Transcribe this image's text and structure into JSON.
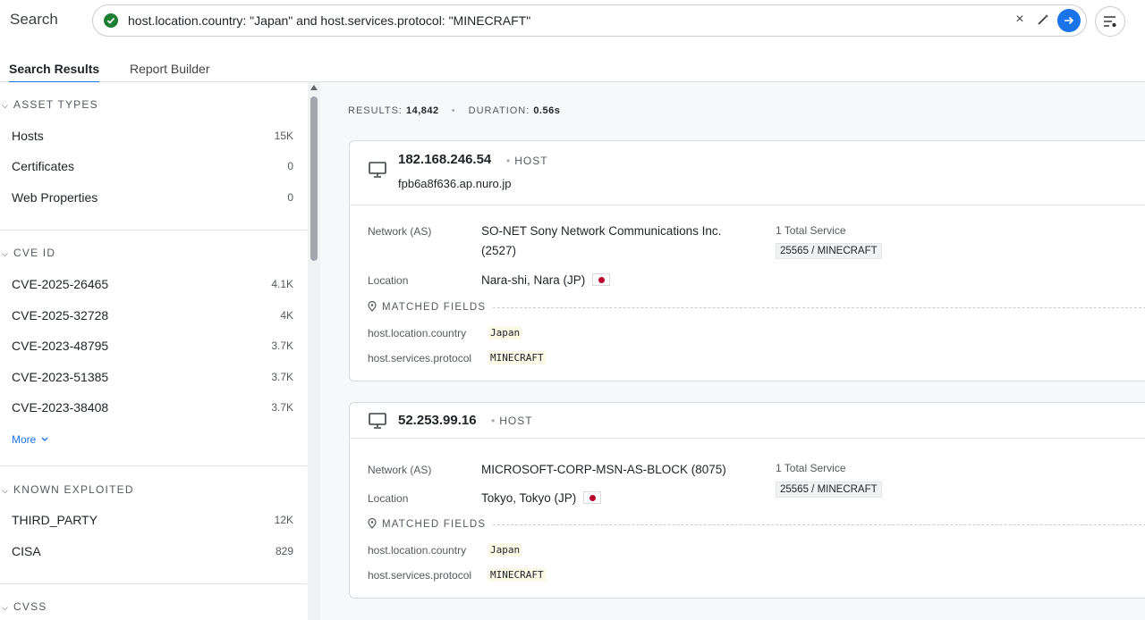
{
  "header": {
    "title": "Search",
    "query": "host.location.country: \"Japan\" and host.services.protocol: \"MINECRAFT\"",
    "clear_glyph": "×"
  },
  "tabs": [
    {
      "label": "Search Results",
      "active": true
    },
    {
      "label": "Report Builder",
      "active": false
    }
  ],
  "sidebar": {
    "asset_types": {
      "title": "ASSET TYPES",
      "items": [
        {
          "label": "Hosts",
          "count": "15K"
        },
        {
          "label": "Certificates",
          "count": "0"
        },
        {
          "label": "Web Properties",
          "count": "0"
        }
      ]
    },
    "cve_id": {
      "title": "CVE ID",
      "items": [
        {
          "label": "CVE-2025-26465",
          "count": "4.1K"
        },
        {
          "label": "CVE-2025-32728",
          "count": "4K"
        },
        {
          "label": "CVE-2023-48795",
          "count": "3.7K"
        },
        {
          "label": "CVE-2023-51385",
          "count": "3.7K"
        },
        {
          "label": "CVE-2023-38408",
          "count": "3.7K"
        }
      ],
      "more_label": "More"
    },
    "known_exploited": {
      "title": "KNOWN EXPLOITED",
      "items": [
        {
          "label": "THIRD_PARTY",
          "count": "12K"
        },
        {
          "label": "CISA",
          "count": "829"
        }
      ]
    },
    "cvss": {
      "title": "CVSS"
    }
  },
  "stats": {
    "results_label": "RESULTS:",
    "results_value": "14,842",
    "duration_label": "DURATION:",
    "duration_value": "0.56s"
  },
  "results": [
    {
      "ip": "182.168.246.54",
      "kind": "HOST",
      "hostname": "fpb6a8f636.ap.nuro.jp",
      "network_label": "Network (AS)",
      "network_line1": "SO-NET Sony Network Communications Inc.",
      "network_line2": "(2527)",
      "location_label": "Location",
      "location": "Nara-shi, Nara (JP)",
      "services_title": "1 Total Service",
      "service": "25565 / MINECRAFT",
      "matched_title": "MATCHED FIELDS",
      "matched": [
        {
          "key": "host.location.country",
          "value": "Japan"
        },
        {
          "key": "host.services.protocol",
          "value": "MINECRAFT"
        }
      ]
    },
    {
      "ip": "52.253.99.16",
      "kind": "HOST",
      "network_label": "Network (AS)",
      "network_line1": "MICROSOFT-CORP-MSN-AS-BLOCK (8075)",
      "location_label": "Location",
      "location": "Tokyo, Tokyo (JP)",
      "services_title": "1 Total Service",
      "service": "25565 / MINECRAFT",
      "matched_title": "MATCHED FIELDS",
      "matched": [
        {
          "key": "host.location.country",
          "value": "Japan"
        },
        {
          "key": "host.services.protocol",
          "value": "MINECRAFT"
        }
      ]
    }
  ],
  "colors": {
    "accent": "#1a73e8",
    "valid": "#1e7e34",
    "flag_red": "#bc002d"
  }
}
